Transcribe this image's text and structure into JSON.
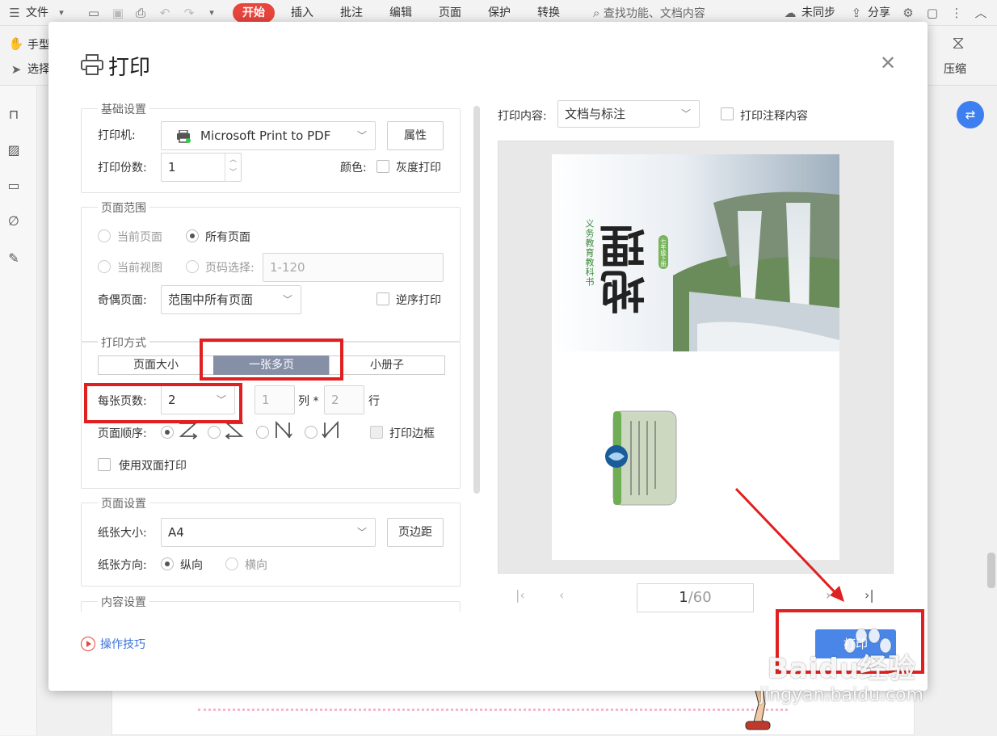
{
  "menubar": {
    "file_label": "文件",
    "tabs": [
      "开始",
      "插入",
      "批注",
      "编辑",
      "页面",
      "保护",
      "转换"
    ],
    "search_placeholder": "查找功能、文档内容",
    "sync_label": "未同步",
    "share_label": "分享"
  },
  "toolbar": {
    "hand_label": "手型",
    "select_label": "选择",
    "compress_label": "压缩"
  },
  "dialog": {
    "title": "打印",
    "basic": {
      "legend": "基础设置",
      "printer_label": "打印机:",
      "printer_value": "Microsoft Print to PDF",
      "properties_button": "属性",
      "copies_label": "打印份数:",
      "copies_value": "1",
      "color_label": "颜色:",
      "grayscale_label": "灰度打印"
    },
    "range": {
      "legend": "页面范围",
      "current_page": "当前页面",
      "all_pages": "所有页面",
      "current_view": "当前视图",
      "page_select": "页码选择:",
      "page_select_value": "1-120",
      "odd_even_label": "奇偶页面:",
      "odd_even_value": "范围中所有页面",
      "reverse_label": "逆序打印"
    },
    "mode": {
      "legend": "打印方式",
      "options": [
        "页面大小",
        "一张多页",
        "小册子"
      ],
      "per_sheet_label": "每张页数:",
      "per_sheet_value": "2",
      "cols_value": "1",
      "cols_label": "列 *",
      "rows_value": "2",
      "rows_label": "行",
      "order_label": "页面顺序:",
      "border_label": "打印边框",
      "duplex_label": "使用双面打印"
    },
    "page_setup": {
      "legend": "页面设置",
      "paper_label": "纸张大小:",
      "paper_value": "A4",
      "margin_button": "页边距",
      "orientation_label": "纸张方向:",
      "portrait": "纵向",
      "landscape": "横向"
    },
    "content": {
      "legend": "内容设置"
    },
    "tips_label": "操作技巧",
    "print_content_label": "打印内容:",
    "print_content_value": "文档与标注",
    "print_annotations_label": "打印注释内容",
    "page_current": "1",
    "page_total": "/60",
    "print_button": "打印"
  },
  "book": {
    "title": "地理",
    "series": "义务教育教科书",
    "grade": "七年级下册"
  },
  "watermark": {
    "logo": "Baidu经验",
    "url": "jingyan.baidu.com"
  },
  "colors": {
    "accent_red": "#e8453c",
    "highlight_red": "#e02020",
    "primary_blue": "#4a86e8",
    "segment_active": "#8590a6"
  }
}
